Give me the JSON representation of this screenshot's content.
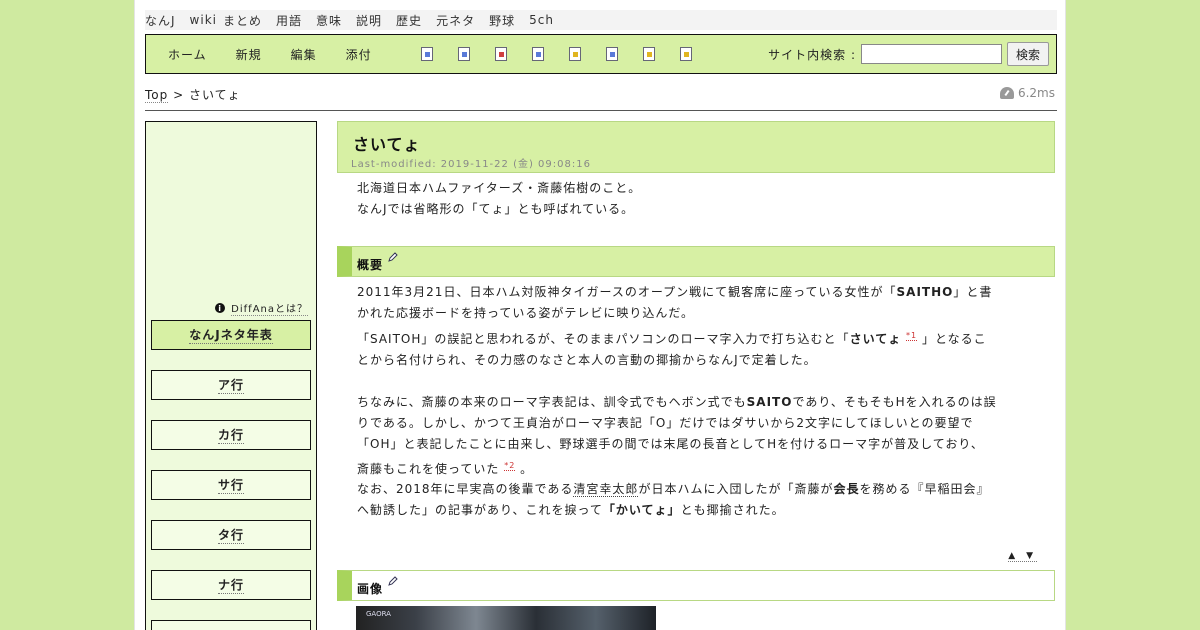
{
  "top_nav": [
    "なんJ",
    "wiki",
    "まとめ",
    "用語",
    "意味",
    "説明",
    "歴史",
    "元ネタ",
    "野球",
    "5ch"
  ],
  "toolbar": {
    "menu": [
      "ホーム",
      "新規",
      "編集",
      "添付"
    ],
    "icons": [
      "new-page-icon",
      "copy-page-icon",
      "diff-icon",
      "backup-icon",
      "lock-icon",
      "list-icon",
      "recent-icon",
      "help-icon"
    ],
    "search_label": "サイト内検索 :",
    "search_value": "",
    "search_button": "検索"
  },
  "breadcrumb": {
    "top": "Top",
    "separator": ">",
    "current": "さいてょ"
  },
  "timing": "6.2ms",
  "sidebar": {
    "about": "DiffAnaとは？",
    "items": [
      "なんJネタ年表",
      "ア行",
      "カ行",
      "サ行",
      "タ行",
      "ナ行"
    ]
  },
  "page": {
    "title": "さいてょ",
    "last_modified": "Last-modified: 2019-11-22 (金) 09:08:16",
    "intro1": "北海道日本ハムファイターズ・斎藤佑樹のこと。",
    "intro2": "なんJでは省略形の「てょ」とも呼ばれている。",
    "section1_title": "概要",
    "p1a": "2011年3月21日、日本ハム対阪神タイガースのオープン戦にて観客席に座っている女性が「",
    "p1b": "SAITHO",
    "p1c": "」と書",
    "p1d": "かれた応援ボードを持っている姿がテレビに映り込んだ。",
    "p2a": "「SAITOH」の誤記と思われるが、そのままパソコンのローマ字入力で打ち込むと「",
    "p2b": "さいてょ",
    "p2n": "*1",
    "p2c": " 」となるこ",
    "p2d": "とから名付けられ、その力感のなさと本人の言動の揶揄からなんJで定着した。",
    "p3a": "ちなみに、斎藤の本来のローマ字表記は、訓令式でもヘボン式でも",
    "p3b": "SAITO",
    "p3c": "であり、そもそもHを入れるのは誤",
    "p3d": "りである。しかし、かつて王貞治がローマ字表記「O」だけではダサいから2文字にしてほしいとの要望で",
    "p3e": "「OH」と表記したことに由来し、野球選手の間では末尾の長音としてHを付けるローマ字が普及しており、",
    "p3f": "斎藤もこれを使っていた",
    "p3n": "*2",
    "p3g": " 。",
    "p4a": "なお、2018年に早実高の後輩である",
    "p4link": "清宮幸太郎",
    "p4b": "が日本ハムに入団したが「斎藤が",
    "p4bold": "会長",
    "p4c": "を務める『早稲田会』",
    "p4d": "へ勧誘した」の記事があり、これを捩って",
    "p4bold2": "「かいてょ」",
    "p4e": "とも揶揄された。",
    "updown": "▲ ▼",
    "section2_title": "画像",
    "image_logo": "GAORA"
  },
  "colors": {
    "accent": "#d7f0a4",
    "accent_dark": "#a8d45c",
    "background": "#cfeaa0"
  }
}
